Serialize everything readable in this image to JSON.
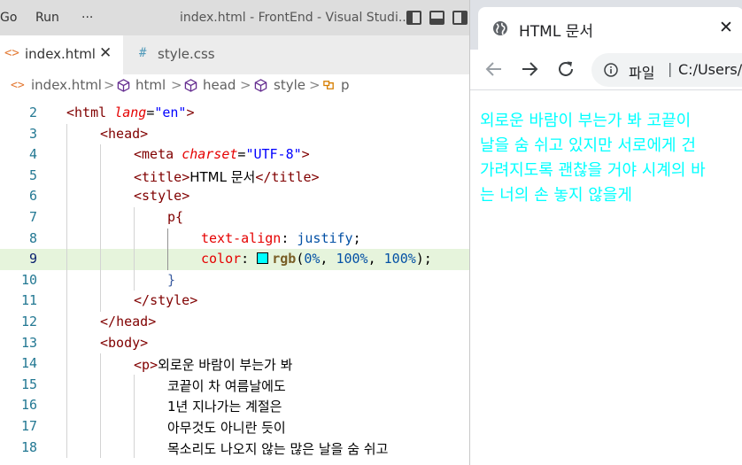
{
  "vscode": {
    "menu": [
      "Go",
      "Run",
      "···"
    ],
    "window_title": "index.html - FrontEnd - Visual Studi...",
    "tabs": [
      {
        "icon": "<>",
        "label": "index.html",
        "close": "✕"
      },
      {
        "icon": "#",
        "label": "style.css"
      }
    ],
    "breadcrumb": [
      "index.html",
      "html",
      "head",
      "style",
      "p"
    ],
    "breadcrumb_sep": ">",
    "line_numbers": [
      "2",
      "3",
      "4",
      "5",
      "6",
      "7",
      "8",
      "9",
      "10",
      "11",
      "12",
      "13",
      "14",
      "15",
      "16",
      "17",
      "18"
    ],
    "code": {
      "l2_open": "<",
      "l2_tag": "html",
      "l2_attr": "lang",
      "l2_eq": "=",
      "l2_val": "\"en\"",
      "l2_close": ">",
      "l3_open": "<",
      "l3_tag": "head",
      "l3_close": ">",
      "l4_open": "<",
      "l4_tag": "meta",
      "l4_attr": "charset",
      "l4_eq": "=",
      "l4_val": "\"UTF-8\"",
      "l4_close": ">",
      "l5_open": "<",
      "l5_tag": "title",
      "l5_close": ">",
      "l5_text": "HTML 문서",
      "l5_end_open": "</",
      "l5_end_tag": "title",
      "l5_end_close": ">",
      "l6_open": "<",
      "l6_tag": "style",
      "l6_close": ">",
      "l7_sel": "p{",
      "l8_prop": "text-align",
      "l8_colon": ": ",
      "l8_val": "justify",
      "l8_semi": ";",
      "l9_prop": "color",
      "l9_colon": ": ",
      "l9_fn": "rgb",
      "l9_paren_open": "(",
      "l9_a": "0%",
      "l9_c1": ", ",
      "l9_b": "100%",
      "l9_c2": ", ",
      "l9_c": "100%",
      "l9_paren_close": ");",
      "l10_brace": "}",
      "l11_open": "</",
      "l11_tag": "style",
      "l11_close": ">",
      "l12_open": "</",
      "l12_tag": "head",
      "l12_close": ">",
      "l13_open": "<",
      "l13_tag": "body",
      "l13_close": ">",
      "l14_open": "<",
      "l14_tag": "p",
      "l14_close": ">",
      "l14_text": "외로운 바람이 부는가 봐",
      "l15_text": "코끝이 차 여름날에도",
      "l16_text": "1년 지나가는 계절은",
      "l17_text": "아무것도 아니란 듯이",
      "l18_text": "목소리도 나오지 않는 많은 날을 숨 쉬고"
    },
    "swatch_color": "#00ffff"
  },
  "browser": {
    "tab_title": "HTML 문서",
    "tab_close": "✕",
    "url_scheme": "파일",
    "url_sep": "|",
    "url": "C:/Users/v",
    "paragraph_lines": [
      "외로운 바람이 부는가 봐 코끝이",
      "날을 숨 쉬고 있지만 서로에게 건",
      "가려지도록 괜찮을 거야 시계의 바",
      "는 너의 손 놓지 않을게"
    ],
    "text_color": "#00ffff"
  }
}
